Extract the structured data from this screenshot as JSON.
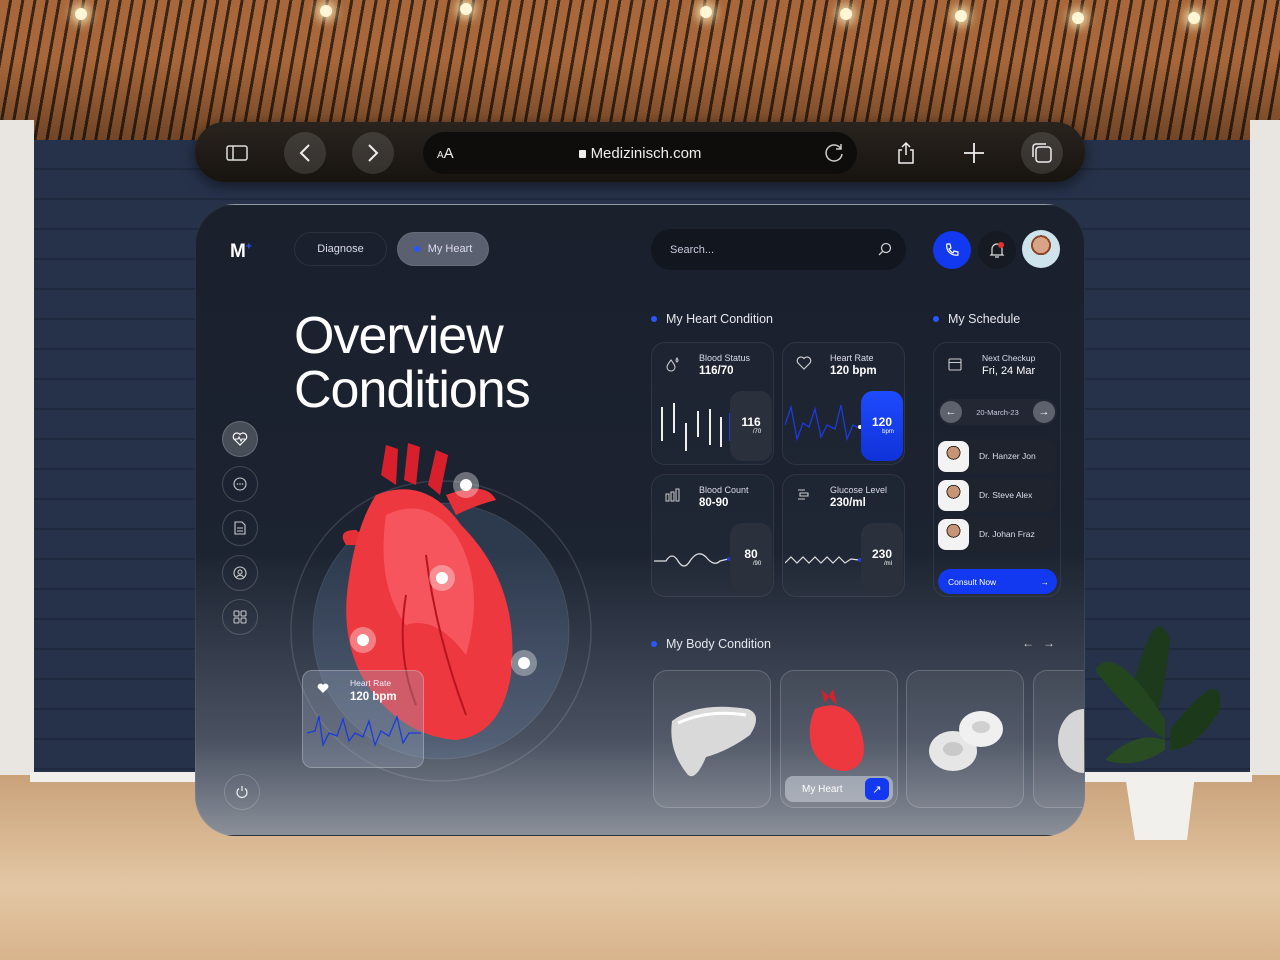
{
  "browser": {
    "url": "Medizinisch.com",
    "text_size_small": "A",
    "text_size_large": "A",
    "icons": [
      "sidebar-icon",
      "back-icon",
      "forward-icon",
      "lock-icon",
      "reload-icon",
      "share-icon",
      "new-tab-icon",
      "tabs-icon"
    ]
  },
  "app": {
    "logo": "M",
    "logo_mark": "+",
    "tabs": [
      {
        "label": "Diagnose",
        "active": false
      },
      {
        "label": "My Heart",
        "active": true
      }
    ],
    "search_placeholder": "Search...",
    "accent": "#1238f0",
    "notification_dot_color": "#e5322d"
  },
  "hero": {
    "title_line1": "Overview",
    "title_line2": "Conditions",
    "heart_rate_label": "Heart Rate",
    "heart_rate_value": "120 bpm"
  },
  "sidebar": {
    "icons": [
      "heart-pulse-icon",
      "chat-icon",
      "document-icon",
      "user-icon",
      "grid-icon",
      "power-icon"
    ]
  },
  "heart_condition": {
    "title": "My Heart Condition",
    "cards": [
      {
        "label": "Blood Status",
        "value": "116/70",
        "pill_big": "116",
        "pill_small": "/70",
        "icon": "blood-drop-icon"
      },
      {
        "label": "Heart Rate",
        "value": "120 bpm",
        "pill_big": "120",
        "pill_small": "bpm",
        "icon": "heart-icon"
      },
      {
        "label": "Blood Count",
        "value": "80-90",
        "pill_big": "80",
        "pill_small": "/90",
        "icon": "bar-chart-icon"
      },
      {
        "label": "Glucose Level",
        "value": "230/ml",
        "pill_big": "230",
        "pill_small": "/ml",
        "icon": "glucose-icon"
      }
    ]
  },
  "schedule": {
    "title": "My Schedule",
    "next_label": "Next Checkup",
    "next_date": "Fri, 24 Mar",
    "date": "20-March-23",
    "doctors": [
      "Dr. Hanzer Jon",
      "Dr. Steve Alex",
      "Dr. Johan Fraz"
    ],
    "consult_label": "Consult Now"
  },
  "body_condition": {
    "title": "My Body Condition",
    "items": [
      {
        "name": "liver"
      },
      {
        "name": "heart",
        "label": "My Heart"
      },
      {
        "name": "blood-cells"
      },
      {
        "name": "brain"
      }
    ]
  }
}
